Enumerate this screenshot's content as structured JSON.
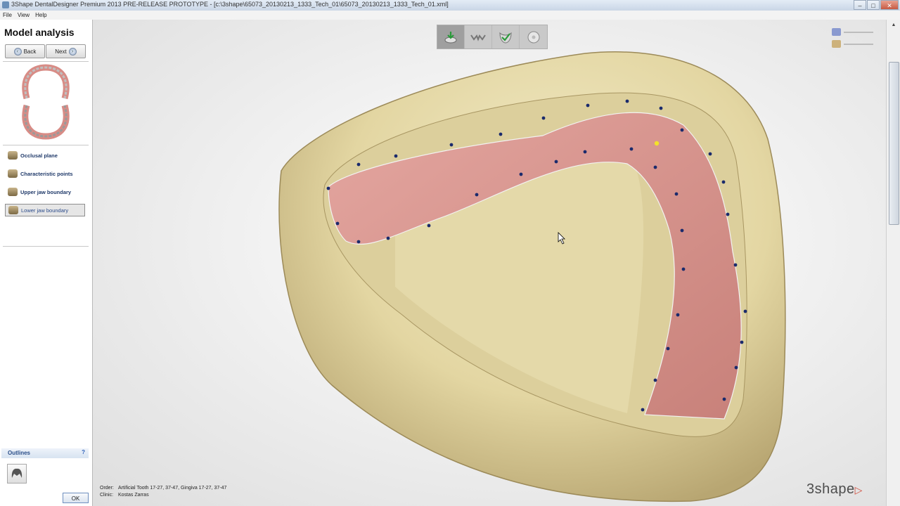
{
  "window": {
    "title": "3Shape DentalDesigner Premium 2013 PRE-RELEASE PROTOTYPE  - [c:\\3shape\\65073_20130213_1333_Tech_01\\65073_20130213_1333_Tech_01.xml]"
  },
  "menu": [
    "File",
    "View",
    "Help"
  ],
  "panel": {
    "title": "Model analysis",
    "back_label": "Back",
    "next_label": "Next",
    "steps": [
      {
        "label": "Occlusal plane",
        "icon": "occlusal-plane-icon"
      },
      {
        "label": "Characteristic points",
        "icon": "characteristic-points-icon"
      },
      {
        "label": "Upper jaw boundary",
        "icon": "upper-jaw-icon"
      },
      {
        "label": "Lower jaw boundary",
        "icon": "lower-jaw-icon",
        "active": true
      }
    ],
    "outlines_label": "Outlines",
    "help_label": "?",
    "ok_label": "OK"
  },
  "toolbar": {
    "items": [
      {
        "name": "model-analysis-tool",
        "active": true
      },
      {
        "name": "teeth-setup-tool",
        "active": false
      },
      {
        "name": "gingiva-tool",
        "active": false
      },
      {
        "name": "export-tool",
        "active": false
      }
    ]
  },
  "info": {
    "order_label": "Order:",
    "order_value": "Artificial Tooth 17-27, 37-47, Gingiva 17-27, 37-47",
    "clinic_label": "Clinic:",
    "clinic_value": "Kostas Zarras"
  },
  "brand": {
    "logo_text": "3shape"
  },
  "colors": {
    "model": "#e8dcae",
    "gingiva": "#d99590",
    "boundary_dots": "#1a2a6c",
    "highlight_dot": "#f3e12a",
    "accent": "#2b4f89"
  }
}
